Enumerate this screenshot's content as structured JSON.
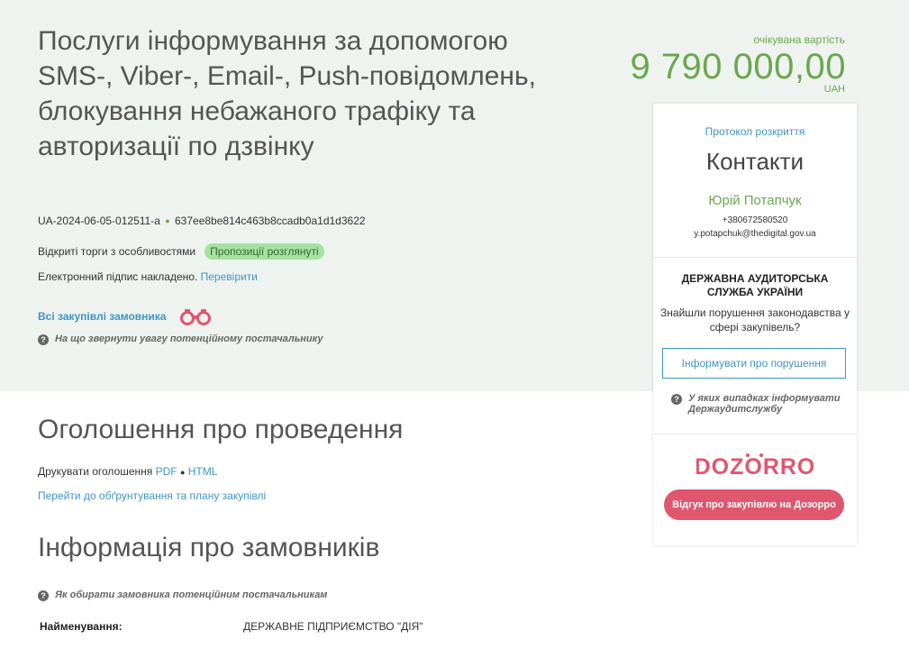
{
  "tender": {
    "title": "Послуги інформування за допомогою SMS-, Viber-, Email-, Push-повідомлень, блокування небажаного трафіку та авторизації по дзвінку",
    "id": "UA-2024-06-05-012511-a",
    "hash": "637ee8be814c463b8ccadb0a1d1d3622",
    "procedure_type": "Відкриті торги з особливостями",
    "status_badge": "Пропозиції розглянуті",
    "signature_text": "Електронний підпис накладено.",
    "signature_link": "Перевірити",
    "all_purchases_link": "Всі закупівлі замовника",
    "hint_attention": "На що звернути увагу потенційному постачальнику"
  },
  "price": {
    "label": "очікувана вартість",
    "amount": "9 790 000,00",
    "currency": "UAH"
  },
  "contacts_panel": {
    "protocol_link": "Протокол розкриття",
    "heading": "Контакти",
    "name": "Юрій Потапчук",
    "phone": "+380672580520",
    "email": "y.potapchuk@thedigital.gov.ua",
    "audit_title": "ДЕРЖАВНА АУДИТОРСЬКА СЛУЖБА УКРАЇНИ",
    "audit_question": "Знайшли порушення законодавства у сфері закупівель?",
    "inform_button": "Інформувати про порушення",
    "inform_hint": "У яких випадках інформувати Держаудитслужбу",
    "dozorro_logo_text": "DOZORRO",
    "dozorro_button": "Відгук про закупівлю на Дозорро"
  },
  "announcement": {
    "heading": "Оголошення про проведення",
    "print_label": "Друкувати оголошення",
    "pdf_link": "PDF",
    "separator": "●",
    "html_link": "HTML",
    "plan_link": "Перейти до обґрунтування та плану закупівлі"
  },
  "customers": {
    "heading": "Інформація про замовників",
    "hint": "Як обирати замовника потенційним постачальникам",
    "name_label": "Найменування:",
    "name_value": "ДЕРЖАВНЕ ПІДПРИЄМСТВО \"ДІЯ\""
  },
  "colors": {
    "accent_green": "#6aa84f",
    "link_blue": "#3f95c6",
    "dozorro_red": "#e0566e",
    "hero_bg": "#eef3ef"
  },
  "icons": [
    "question-icon",
    "binoculars-icon",
    "dozorro-logo"
  ]
}
